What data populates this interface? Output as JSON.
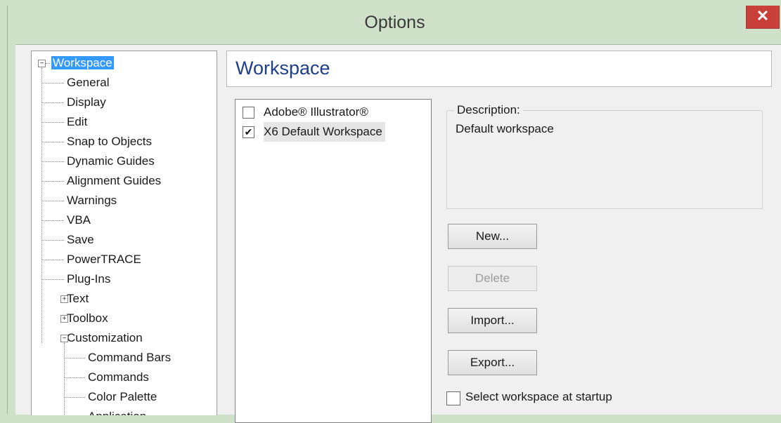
{
  "window": {
    "title": "Options",
    "close_glyph": "✕"
  },
  "tree": {
    "items": [
      {
        "label": "Workspace",
        "level": 0,
        "expander": "−",
        "selected": true
      },
      {
        "label": "General",
        "level": 1
      },
      {
        "label": "Display",
        "level": 1
      },
      {
        "label": "Edit",
        "level": 1
      },
      {
        "label": "Snap to Objects",
        "level": 1
      },
      {
        "label": "Dynamic Guides",
        "level": 1
      },
      {
        "label": "Alignment Guides",
        "level": 1
      },
      {
        "label": "Warnings",
        "level": 1
      },
      {
        "label": "VBA",
        "level": 1
      },
      {
        "label": "Save",
        "level": 1
      },
      {
        "label": "PowerTRACE",
        "level": 1
      },
      {
        "label": "Plug-Ins",
        "level": 1
      },
      {
        "label": "Text",
        "level": 1,
        "expander": "+"
      },
      {
        "label": "Toolbox",
        "level": 1,
        "expander": "+"
      },
      {
        "label": "Customization",
        "level": 1,
        "expander": "−"
      },
      {
        "label": "Command Bars",
        "level": 2
      },
      {
        "label": "Commands",
        "level": 2
      },
      {
        "label": "Color Palette",
        "level": 2
      },
      {
        "label": "Application",
        "level": 2
      }
    ]
  },
  "panel": {
    "title": "Workspace"
  },
  "workspaces": [
    {
      "label": "Adobe® Illustrator®",
      "checked": false
    },
    {
      "label": "X6 Default Workspace",
      "checked": true
    }
  ],
  "description": {
    "legend": "Description:",
    "text": "Default workspace"
  },
  "buttons": {
    "new": "New...",
    "delete": "Delete",
    "import": "Import...",
    "export": "Export..."
  },
  "startup": {
    "label": "Select workspace at startup",
    "checked": false
  },
  "icons": {
    "checkmark": "✔"
  }
}
